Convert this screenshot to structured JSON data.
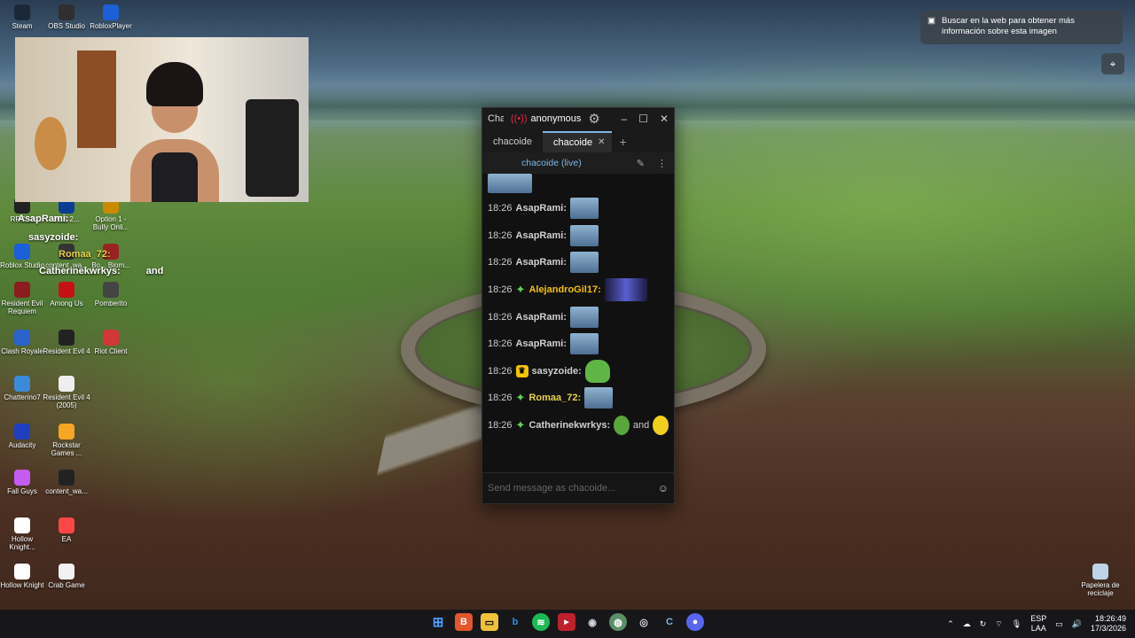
{
  "desktop": {
    "icons": [
      {
        "label": "Steam",
        "icon": "steam-icon",
        "color": "#1b2838"
      },
      {
        "label": "OBS Studio",
        "icon": "obs-icon",
        "color": "#302e31"
      },
      {
        "label": "RobloxPlayer",
        "icon": "roblox-icon",
        "color": "#1d5fd6"
      },
      {
        "label": "RPCS3",
        "icon": "rpcs3-icon",
        "color": "#222222"
      },
      {
        "label": "PES 2...",
        "icon": "pes-icon",
        "color": "#0b3d91"
      },
      {
        "label": "Option 1 - Bully Onli...",
        "icon": "bully-icon",
        "color": "#cc8a00"
      },
      {
        "label": "Roblox Studio",
        "icon": "roblox-studio-icon",
        "color": "#1d5fd6"
      },
      {
        "label": "content_wa...",
        "icon": "file-icon",
        "color": "#333333"
      },
      {
        "label": "Bo... Biom...",
        "icon": "game-icon",
        "color": "#992222"
      },
      {
        "label": "Resident Evil Requiem",
        "icon": "re-icon",
        "color": "#8a1d1d"
      },
      {
        "label": "Among Us",
        "icon": "among-us-icon",
        "color": "#c51111"
      },
      {
        "label": "Pomberito",
        "icon": "pomberito-icon",
        "color": "#444444"
      },
      {
        "label": "Clash Royale",
        "icon": "clash-royale-icon",
        "color": "#2a62c9"
      },
      {
        "label": "Resident Evil 4",
        "icon": "re4-icon",
        "color": "#222222"
      },
      {
        "label": "Riot Client",
        "icon": "riot-icon",
        "color": "#d13639"
      },
      {
        "label": "Chatterino7",
        "icon": "chatterino-icon",
        "color": "#3a8ad8"
      },
      {
        "label": "Resident Evil 4 (2005)",
        "icon": "re4-2005-icon",
        "color": "#eeeeee"
      },
      {
        "label": "Audacity",
        "icon": "audacity-icon",
        "color": "#1f3fbf"
      },
      {
        "label": "Rockstar Games ...",
        "icon": "rockstar-icon",
        "color": "#f5a623"
      },
      {
        "label": "Fall Guys",
        "icon": "fall-guys-icon",
        "color": "#c45cf2"
      },
      {
        "label": "content_wa...",
        "icon": "file-icon",
        "color": "#222222"
      },
      {
        "label": "Hollow Knight...",
        "icon": "hollow-knight-icon",
        "color": "#ffffff"
      },
      {
        "label": "EA",
        "icon": "ea-icon",
        "color": "#ff4747"
      },
      {
        "label": "Hollow Knight",
        "icon": "hollow-knight-icon",
        "color": "#ffffff"
      },
      {
        "label": "Crab Game",
        "icon": "crab-game-icon",
        "color": "#f2f2f2"
      },
      {
        "label": "Papelera de reciclaje",
        "icon": "recycle-bin-icon",
        "color": "#bcd3e8"
      }
    ]
  },
  "overlay_chat": {
    "line1": "AsapRami:",
    "line2": "sasyzoide:",
    "line3": "Romaa_72:",
    "line4_user": "Catherinekwrkys:",
    "line4_text": "and"
  },
  "notification": {
    "text": "Buscar en la web para obtener más información sobre esta imagen"
  },
  "chat_window": {
    "title": "Cha",
    "account": "anonymous",
    "tabs": [
      {
        "label": "chacoide"
      },
      {
        "label": "chacoide"
      }
    ],
    "channel": "chacoide (live)",
    "messages": [
      {
        "time": "18:26",
        "user": "AsapRami:",
        "color": "#d0d0d0",
        "emote": "thumb"
      },
      {
        "time": "18:26",
        "user": "AsapRami:",
        "color": "#d0d0d0",
        "emote": "thumb"
      },
      {
        "time": "18:26",
        "user": "AsapRami:",
        "color": "#d0d0d0",
        "emote": "thumb"
      },
      {
        "time": "18:26",
        "user": "AlejandroGil17:",
        "color": "#f2c200",
        "emote": "wide"
      },
      {
        "time": "18:26",
        "user": "AsapRami:",
        "color": "#d0d0d0",
        "emote": "thumb"
      },
      {
        "time": "18:26",
        "user": "AsapRami:",
        "color": "#d0d0d0",
        "emote": "thumb"
      },
      {
        "time": "18:26",
        "user": "sasyzoide:",
        "color": "#d0d0d0",
        "emote": "pepe"
      },
      {
        "time": "18:26",
        "user": "Romaa_72:",
        "color": "#e8d24a",
        "emote": "thumb"
      },
      {
        "time": "18:26",
        "user": "Catherinekwrkys:",
        "color": "#d0d0d0",
        "text": "and"
      }
    ],
    "input_placeholder": "Send message as chacoide..."
  },
  "taskbar": {
    "lang_top": "ESP",
    "lang_bottom": "LAA",
    "time": "18:26:49",
    "date": "17/3/2026"
  }
}
